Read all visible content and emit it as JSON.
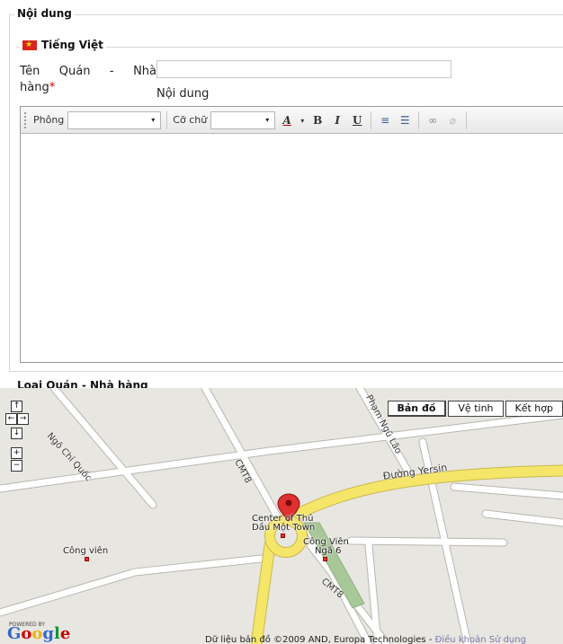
{
  "form": {
    "section_title": "Nội dung",
    "language_title": "Tiếng Việt",
    "name_label_words": [
      "Tên",
      "Quán",
      "-",
      "Nhà"
    ],
    "name_label_line2": "hàng",
    "required_mark": "*",
    "name_value": "",
    "content_label": "Nội dung",
    "next_section_title": "Loại Quán - Nhà hàng"
  },
  "toolbar": {
    "font_label": "Phông",
    "size_label": "Cỡ chữ",
    "font_value": "",
    "size_value": "",
    "dropdown_icon": "▾",
    "text_color_glyph": "A",
    "bold_glyph": "B",
    "italic_glyph": "I",
    "underline_glyph": "U",
    "ordered_list_glyph": "≡",
    "unordered_list_glyph": "☰",
    "link_glyph": "∞",
    "unlink_glyph": "⌀",
    "accent_color": "#cc0000"
  },
  "map": {
    "type_buttons": [
      "Bản đồ",
      "Vệ tinh",
      "Kết hợp"
    ],
    "active_type": "Bản đồ",
    "pan": {
      "up": "↑",
      "left": "←",
      "right": "→",
      "down": "↓",
      "zoom_in": "+",
      "zoom_out": "−"
    },
    "labels": {
      "ngo_chi_quoc": "Ngô Chí Quốc",
      "pham_ngu_lao": "Phạm Ngũ Lão",
      "cmt8_top": "CMT8",
      "cmt8_bottom": "CMT8",
      "duong_yersin": "Đường Yersin",
      "center_line1": "Center of Thủ",
      "center_line2": "Dầu Một Town",
      "cong_vien_nga6_line1": "Công Viên",
      "cong_vien_nga6_line2": "Ngã 6",
      "cong_vien": "Công viên"
    },
    "powered_by": "POWERED BY",
    "google_letters": [
      "G",
      "o",
      "o",
      "g",
      "l",
      "e"
    ],
    "google_colors": [
      "#3366cc",
      "#cc0000",
      "#f0b400",
      "#3366cc",
      "#009933",
      "#cc0000"
    ],
    "copyright": "Dữ liệu bản đồ ©2009 AND, Europa Technologies - ",
    "terms_link": "Điều khoản Sử dụng",
    "road_yellow": "#f5e66a",
    "road_white": "#ffffff",
    "park_green": "#a8c89a",
    "land": "#e8e6e0"
  }
}
